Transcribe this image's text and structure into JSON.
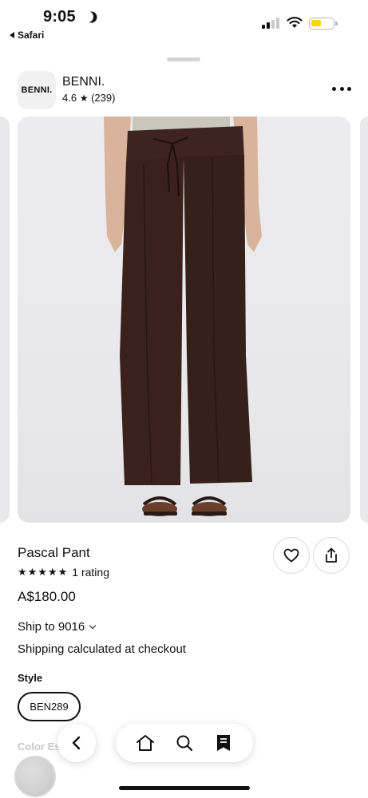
{
  "status_bar": {
    "time": "9:05",
    "back_app": "Safari",
    "battery_color": "#ffd60a"
  },
  "shop": {
    "logo_text": "BENNI.",
    "name": "BENNI.",
    "rating": "4.6",
    "rating_count": "(239)"
  },
  "product": {
    "image_subject": "brown low-rise flared drawstring pants",
    "title": "Pascal Pant",
    "stars": "★★★★★",
    "rating_text": "1 rating",
    "price": "A$180.00",
    "ship_to": "Ship to 9016",
    "shipping_note": "Shipping calculated at checkout",
    "style_label": "Style",
    "style_value": "BEN289",
    "color_label": "Color",
    "color_value": "Es"
  },
  "icons": {
    "more": "more-icon",
    "favorite": "heart-icon",
    "share": "share-icon",
    "back": "chevron-left-icon",
    "home": "home-icon",
    "search": "search-icon",
    "orders": "receipt-icon"
  },
  "colors": {
    "pant": "#3b211b",
    "image_bg": "#ebebee"
  }
}
